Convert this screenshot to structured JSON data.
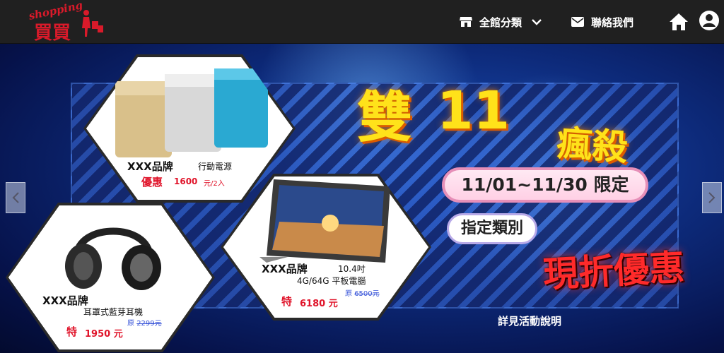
{
  "brand": {
    "script_text": "shopping",
    "main_text": "買買"
  },
  "nav": {
    "category_label": "全館分類",
    "contact_label": "聯絡我們",
    "icons": {
      "category": "shop-icon",
      "dropdown": "chevron-down-icon",
      "contact": "envelope-icon",
      "home": "home-icon",
      "user": "user-circle-icon"
    }
  },
  "banner": {
    "headline_char": "雙",
    "headline_number": "11",
    "headline_suffix": "瘋殺",
    "date_range": "11/01~11/30 限定",
    "category_pill": "指定類別",
    "discount_text": "現折優惠",
    "details_link": "詳見活動說明",
    "products": [
      {
        "brand": "XXX品牌",
        "name": "行動電源",
        "price_tag": "優惠",
        "price": "1600",
        "unit": "元/2入"
      },
      {
        "brand": "XXX品牌",
        "spec_line1": "10.4吋",
        "spec_line2": "4G/64G 平板電腦",
        "orig_label": "原",
        "orig_price": "6500元",
        "price_tag": "特",
        "price": "6180 元"
      },
      {
        "brand": "XXX品牌",
        "name": "耳罩式藍芽耳機",
        "orig_label": "原",
        "orig_price": "2299元",
        "price_tag": "特",
        "price": "1950 元"
      }
    ],
    "colors": {
      "headline": "#ffe21a",
      "discount": "#ff2a2a",
      "price": "#e0142a",
      "pill_border": "#e68fb8"
    }
  },
  "carousel": {
    "prev_icon": "chevron-left-icon",
    "next_icon": "chevron-right-icon"
  }
}
